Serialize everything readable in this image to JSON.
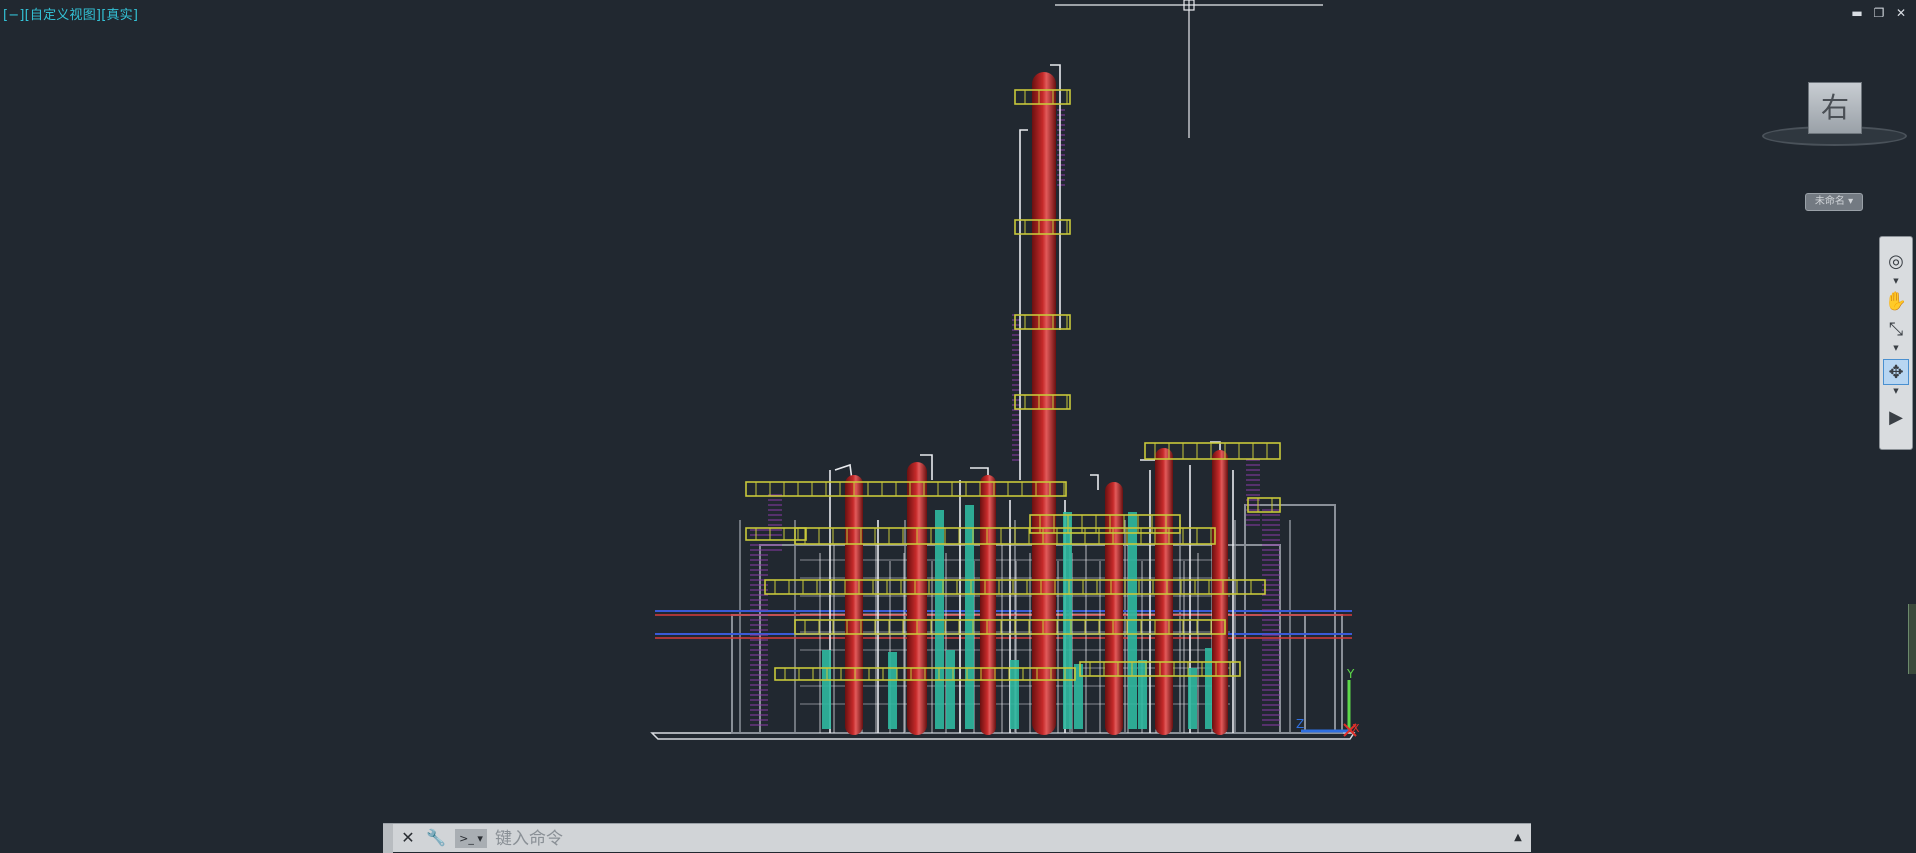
{
  "viewport": {
    "label_minus": "[−]",
    "label_view": "[自定义视图]",
    "label_style": "[真实]",
    "background": "#212830",
    "label_color": "#33c2d6"
  },
  "window_controls": {
    "minimize": "▬",
    "restore": "❐",
    "close": "✕"
  },
  "viewcube": {
    "face_label": "右",
    "ucs_label": "未命名 ▾"
  },
  "navigation_bar": {
    "tools": [
      {
        "name": "steering-wheel-icon",
        "glyph": "◎"
      },
      {
        "name": "pan-icon",
        "glyph": "✋"
      },
      {
        "name": "zoom-extents-icon",
        "glyph": "⤡"
      },
      {
        "name": "orbit-icon",
        "glyph": "✥"
      },
      {
        "name": "showmotion-icon",
        "glyph": "▶"
      }
    ]
  },
  "ucs_icon": {
    "y_label": "Y",
    "z_label": "Z",
    "x_label": "X",
    "y_color": "#5dd84a",
    "x_color": "#e0302a",
    "z_color": "#2f6fe0"
  },
  "command_line": {
    "placeholder": "键入命令",
    "close_icon": "✕",
    "settings_icon": "🔧",
    "prompt_icon": ">_ ▾",
    "expand_icon": "▲"
  },
  "colors": {
    "column_red": "#c62a2a",
    "platform_yellow": "#c8c83a",
    "ladder_purple": "#8c3aa8",
    "equipment_teal": "#2fb8a0",
    "pipe_white": "#e8eaee",
    "steel_gray": "#8a9098",
    "pipe_blue": "#3a5ad8",
    "pipe_red": "#d83a3a"
  }
}
